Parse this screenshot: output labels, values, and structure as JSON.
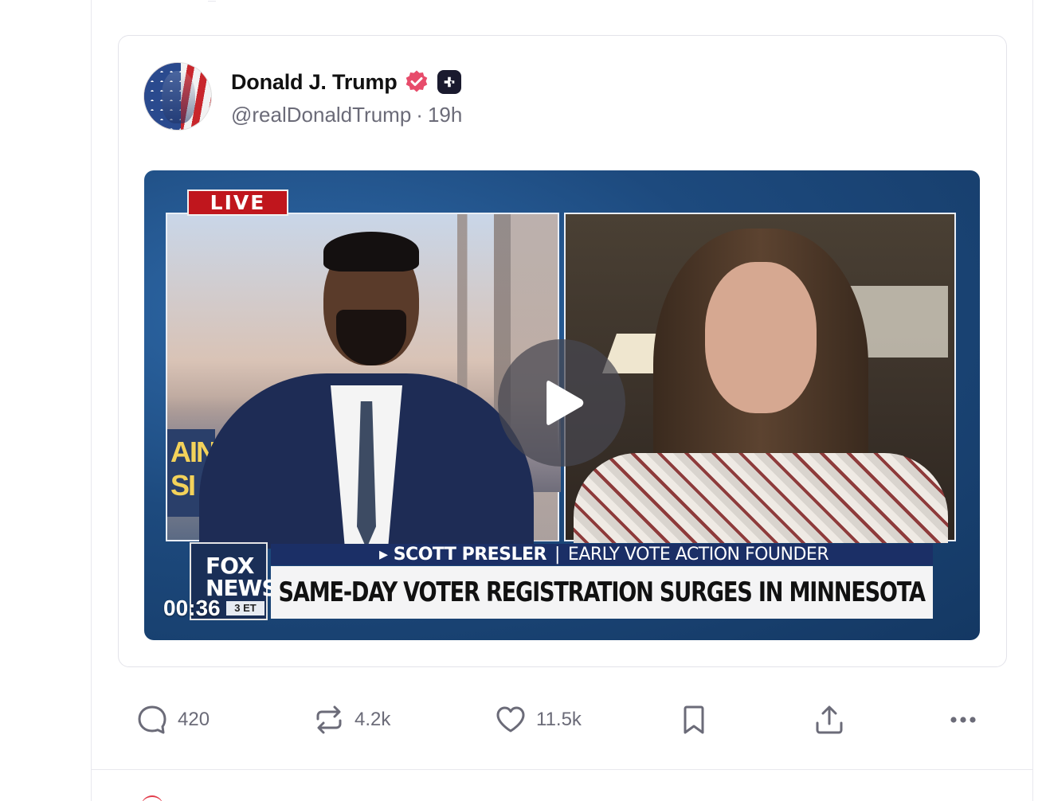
{
  "post": {
    "author": {
      "name": "Donald J. Trump",
      "handle": "@realDonaldTrump",
      "separator": "·",
      "time": "19h"
    },
    "video": {
      "live_label": "LIVE",
      "lower_third_name": "SCOTT PRESLER",
      "lower_third_divider": "|",
      "lower_third_role": "EARLY VOTE ACTION FOUNDER",
      "headline": "SAME-DAY VOTER REGISTRATION SURGES IN MINNESOTA",
      "logo_text": "FOX NEWS",
      "logo_time": "3 ET",
      "sign_text": "AIN SI",
      "duration": "00:36"
    },
    "actions": {
      "replies": "420",
      "reposts": "4.2k",
      "likes": "11.5k"
    }
  },
  "icons": {
    "verified": "verified-badge-icon",
    "plus": "plus-badge-icon",
    "reply": "reply-icon",
    "repost": "repost-icon",
    "like": "heart-icon",
    "bookmark": "bookmark-icon",
    "share": "share-icon",
    "more": "more-icon",
    "play": "play-icon"
  },
  "colors": {
    "verified": "#e74c6b",
    "action_text": "#6b6b78",
    "lower_third_blue": "#1b2f66",
    "live_red": "#c0161d"
  }
}
